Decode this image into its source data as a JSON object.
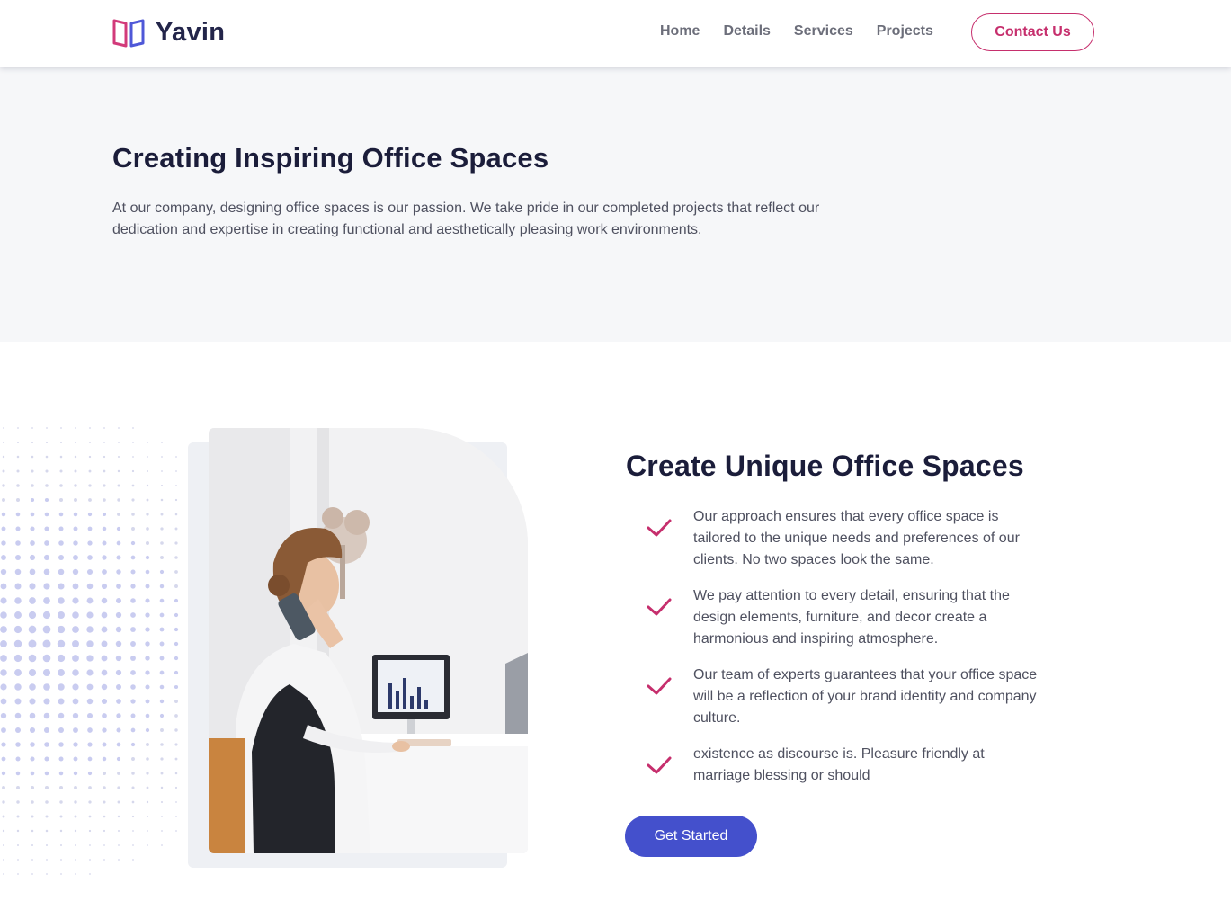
{
  "header": {
    "brand": "Yavin",
    "nav": [
      "Home",
      "Details",
      "Services",
      "Projects"
    ],
    "contact_label": "Contact Us"
  },
  "hero": {
    "title": "Creating Inspiring Office Spaces",
    "text": "At our company, designing office spaces is our passion. We take pride in our completed projects that reflect our dedication and expertise in creating functional and aesthetically pleasing work environments."
  },
  "section": {
    "title": "Create Unique Office Spaces",
    "features": [
      "Our approach ensures that every office space is tailored to the unique needs and preferences of our clients. No two spaces look the same.",
      "We pay attention to every detail, ensuring that the design elements, furniture, and decor create a harmonious and inspiring atmosphere.",
      "Our team of experts guarantees that your office space will be a reflection of your brand identity and company culture.",
      "existence as discourse is. Pleasure friendly at marriage blessing or should"
    ],
    "cta_label": "Get Started"
  },
  "colors": {
    "accent": "#c62f6d",
    "primary": "#4450cc",
    "hero_bg": "#f6f7f9",
    "heading": "#1b1d3a"
  },
  "icons": [
    "logo-icon",
    "check-icon"
  ]
}
